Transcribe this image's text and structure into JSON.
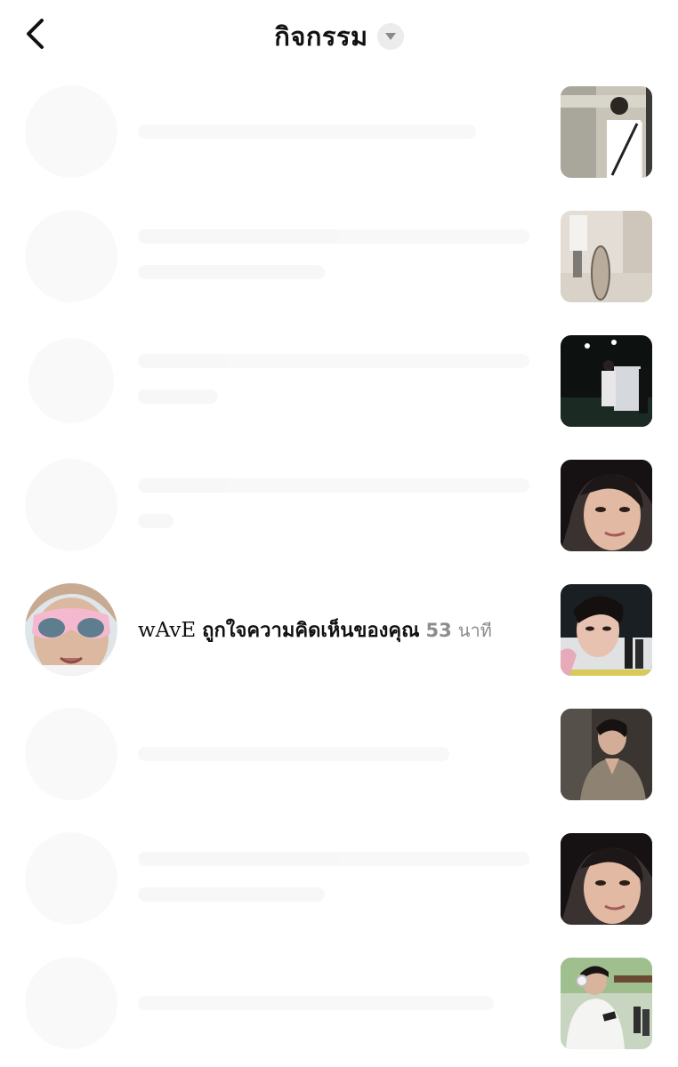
{
  "header": {
    "title": "กิจกรรม",
    "back_icon": "chevron-left-icon",
    "dropdown_icon": "triangle-down-icon"
  },
  "activity": {
    "username": "wAvE",
    "action": "ถูกใจความคิดเห็นของคุณ",
    "time_value": "53",
    "time_unit": "นาที"
  },
  "colors": {
    "background": "#ffffff",
    "text": "#111111",
    "muted": "#8c8c8c",
    "dropdown_bg": "#ececec"
  }
}
